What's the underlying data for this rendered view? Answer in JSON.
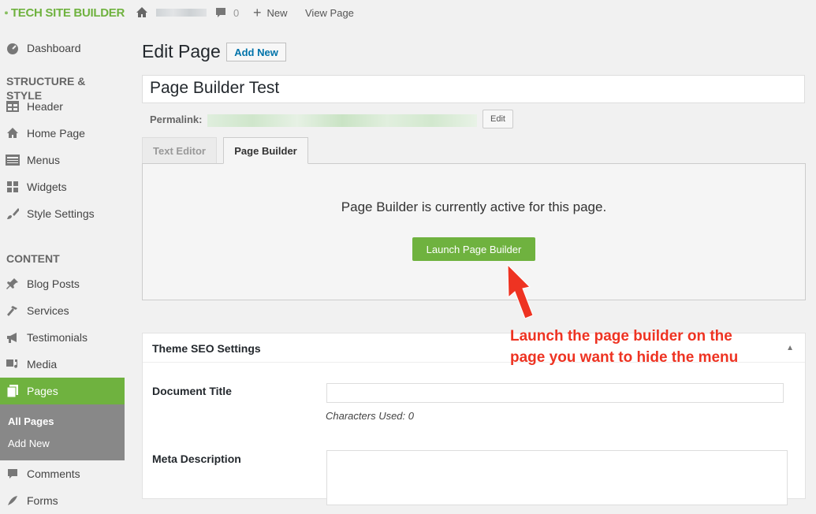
{
  "topbar": {
    "logo_text": "TECH SITE BUILDER",
    "comments_count": "0",
    "new_label": "New",
    "view_page_label": "View Page"
  },
  "sidebar": {
    "dashboard": "Dashboard",
    "structure_heading": "STRUCTURE & STYLE",
    "header": "Header",
    "home_page": "Home Page",
    "menus": "Menus",
    "widgets": "Widgets",
    "style_settings": "Style Settings",
    "content_heading": "CONTENT",
    "blog_posts": "Blog Posts",
    "services": "Services",
    "testimonials": "Testimonials",
    "media": "Media",
    "pages": "Pages",
    "all_pages": "All Pages",
    "add_new": "Add New",
    "comments": "Comments",
    "forms": "Forms"
  },
  "main": {
    "page_title": "Edit Page",
    "add_new_button": "Add New",
    "title_value": "Page Builder Test",
    "permalink_label": "Permalink:",
    "edit_button": "Edit",
    "tab_text_editor": "Text Editor",
    "tab_page_builder": "Page Builder",
    "builder_message": "Page Builder is currently active for this page.",
    "launch_button": "Launch Page Builder"
  },
  "annotation": {
    "line1": "Launch the page builder on the",
    "line2": "page you want to hide the menu"
  },
  "seo": {
    "heading": "Theme SEO Settings",
    "document_title_label": "Document Title",
    "document_title_value": "",
    "chars_used": "Characters Used: 0",
    "meta_description_label": "Meta Description",
    "meta_description_value": ""
  },
  "colors": {
    "accent_green": "#6fb23f",
    "annotation_red": "#ee3322",
    "link_blue": "#0073aa"
  }
}
